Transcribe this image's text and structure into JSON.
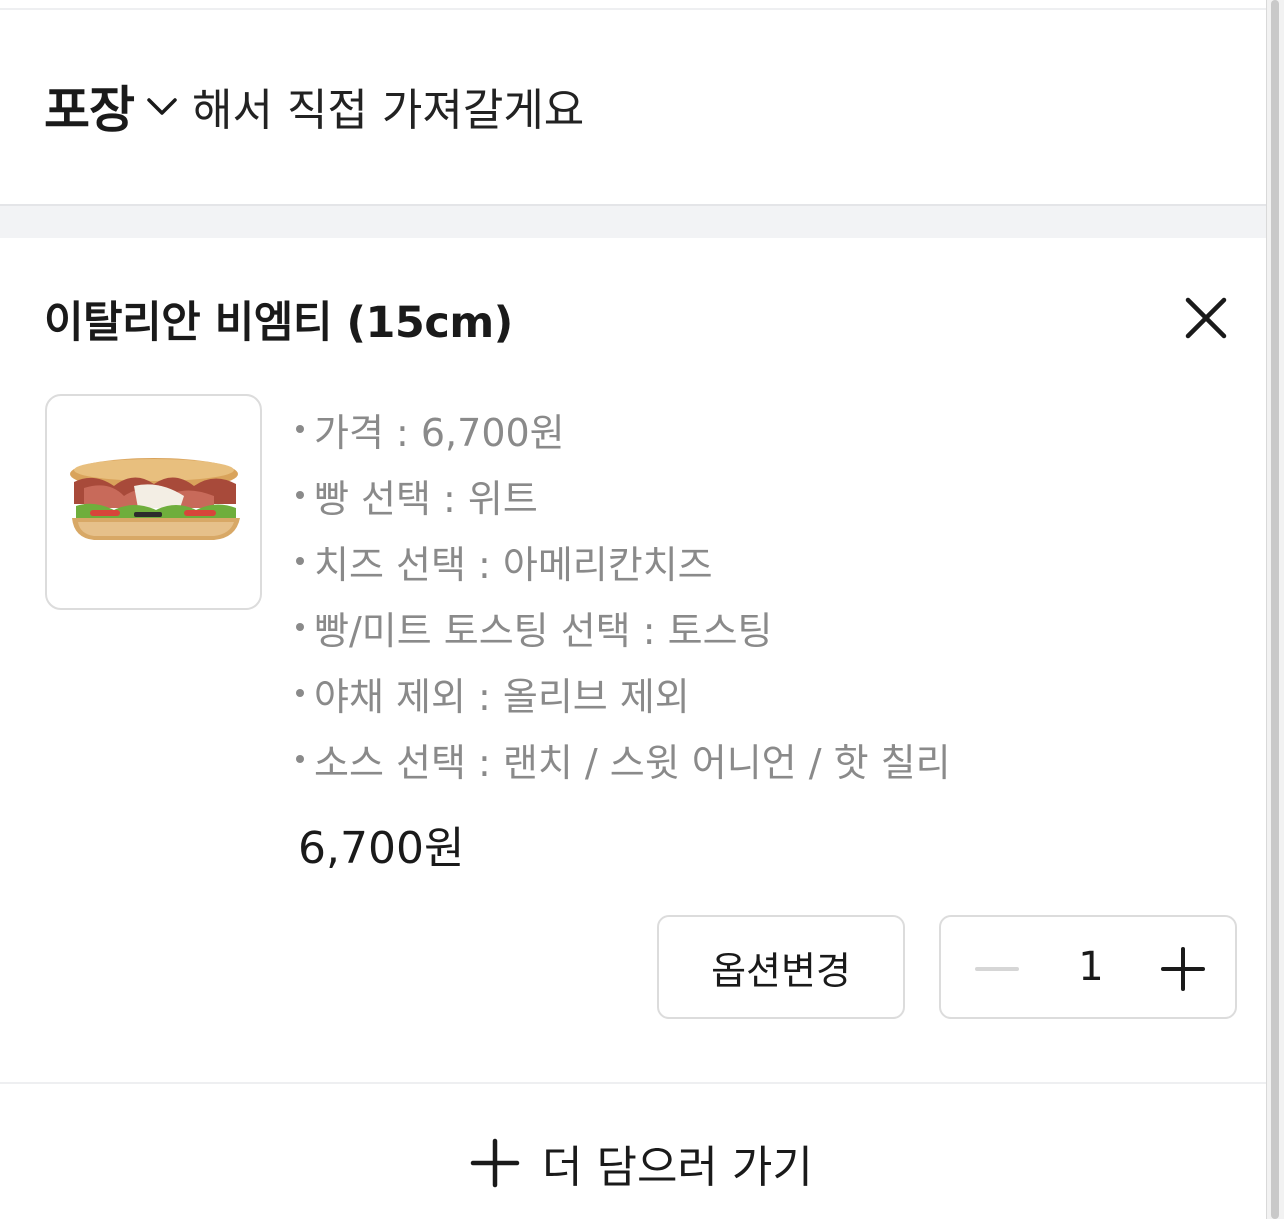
{
  "order_mode": {
    "selected": "포장",
    "suffix": "해서 직접 가져갈게요"
  },
  "cart_item": {
    "title": "이탈리안 비엠티 (15cm)",
    "image_alt": "sandwich",
    "options": [
      "가격 : 6,700원",
      "빵 선택 : 위트",
      "치즈 선택 : 아메리칸치즈",
      "빵/미트 토스팅 선택 : 토스팅",
      "야채 제외 : 올리브 제외",
      "소스 선택 : 랜치 / 스윗 어니언 / 핫 칠리"
    ],
    "price": "6,700원",
    "change_options_label": "옵션변경",
    "quantity": "1"
  },
  "add_more": {
    "label": "더 담으러 가기"
  },
  "colors": {
    "text_primary": "#1a1a1a",
    "text_secondary": "#8a8a8a",
    "border": "#dcdcdc",
    "section_band": "#f2f3f5",
    "disabled_icon": "#d6d6d6"
  },
  "icons": [
    "chevron-down-icon",
    "close-icon",
    "minus-icon",
    "plus-icon"
  ]
}
